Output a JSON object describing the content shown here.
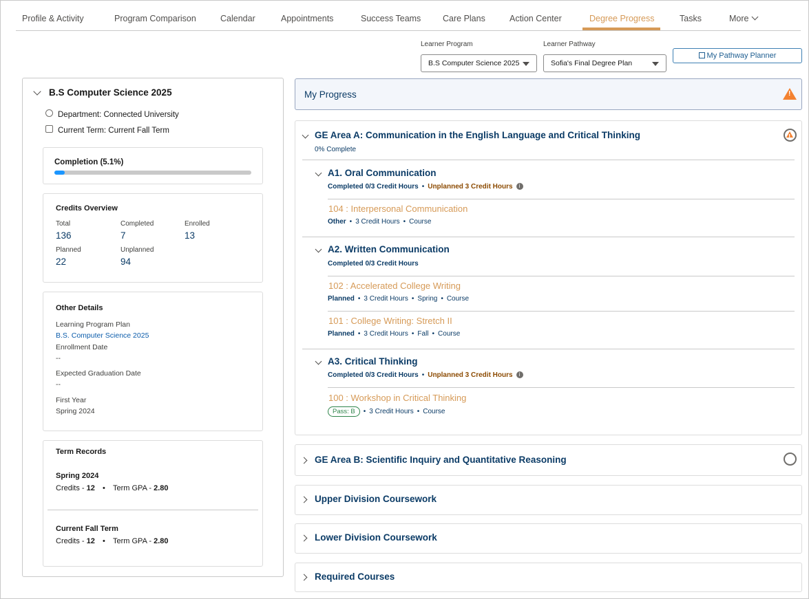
{
  "tabs": [
    {
      "label": "Profile & Activity"
    },
    {
      "label": "Program Comparison"
    },
    {
      "label": "Calendar"
    },
    {
      "label": "Appointments"
    },
    {
      "label": "Success Teams"
    },
    {
      "label": "Care Plans"
    },
    {
      "label": "Action Center"
    },
    {
      "label": "Degree Progress"
    },
    {
      "label": "Tasks"
    },
    {
      "label": "More"
    }
  ],
  "active_tab": "Degree Progress",
  "accent_color": "#d69a57",
  "filters": {
    "program_label": "Learner Program",
    "program_value": "B.S Computer Science 2025",
    "pathway_label": "Learner Pathway",
    "pathway_value": "Sofia's Final Degree Plan",
    "planner_button": "My Pathway Planner"
  },
  "program": {
    "title": "B.S Computer Science 2025",
    "department": "Department: Connected University",
    "term": "Current Term: Current Fall Term",
    "completion_label": "Completion (5.1%)",
    "completion_fraction": 0.051
  },
  "credits": {
    "heading": "Credits Overview",
    "items": [
      {
        "label": "Total",
        "value": "136"
      },
      {
        "label": "Completed",
        "value": "7"
      },
      {
        "label": "Enrolled",
        "value": "13"
      },
      {
        "label": "Planned",
        "value": "22"
      },
      {
        "label": "Unplanned",
        "value": "94"
      }
    ]
  },
  "other_details": {
    "heading": "Other Details",
    "plan_label": "Learning Program Plan",
    "plan_value": "B.S. Computer Science 2025",
    "enroll_label": "Enrollment Date",
    "enroll_value": "--",
    "grad_label": "Expected Graduation Date",
    "grad_value": "--",
    "first_year_label": "First Year",
    "first_year_value": "Spring 2024"
  },
  "term_records": {
    "heading": "Term Records",
    "terms": [
      {
        "name": "Spring 2024",
        "credits_label": "Credits - ",
        "credits": "12",
        "gpa_label": "Term GPA - ",
        "gpa": "2.80"
      },
      {
        "name": "Current Fall Term",
        "credits_label": "Credits - ",
        "credits": "12",
        "gpa_label": "Term GPA - ",
        "gpa": "2.80"
      }
    ]
  },
  "progress": {
    "title": "My Progress",
    "area_a": {
      "title": "GE Area A: Communication in the English Language and Critical Thinking",
      "status": "0% Complete",
      "groups": [
        {
          "title": "A1. Oral Communication",
          "completed": "Completed 0/3 Credit Hours",
          "unplanned": "Unplanned 3 Credit Hours",
          "courses": [
            {
              "name": "104 : Interpersonal Communication",
              "status": "Other",
              "credits": "3 Credit Hours",
              "type": "Course"
            }
          ]
        },
        {
          "title": "A2. Written Communication",
          "completed": "Completed 0/3 Credit Hours",
          "courses": [
            {
              "name": "102 : Accelerated College Writing",
              "status": "Planned",
              "credits": "3 Credit Hours",
              "term": "Spring",
              "type": "Course"
            },
            {
              "name": "101 : College Writing: Stretch II",
              "status": "Planned",
              "credits": "3 Credit Hours",
              "term": "Fall",
              "type": "Course"
            }
          ]
        },
        {
          "title": "A3. Critical Thinking",
          "completed": "Completed 0/3 Credit Hours",
          "unplanned": "Unplanned 3 Credit Hours",
          "courses": [
            {
              "name": "100 : Workshop in Critical Thinking",
              "badge": "Pass: B",
              "credits": "3 Credit Hours",
              "type": "Course"
            }
          ]
        }
      ]
    },
    "collapsed_sections": [
      {
        "title": "GE Area B: Scientific Inquiry and Quantitative Reasoning"
      },
      {
        "title": "Upper Division Coursework"
      },
      {
        "title": "Lower Division Coursework"
      },
      {
        "title": "Required Courses"
      }
    ]
  }
}
